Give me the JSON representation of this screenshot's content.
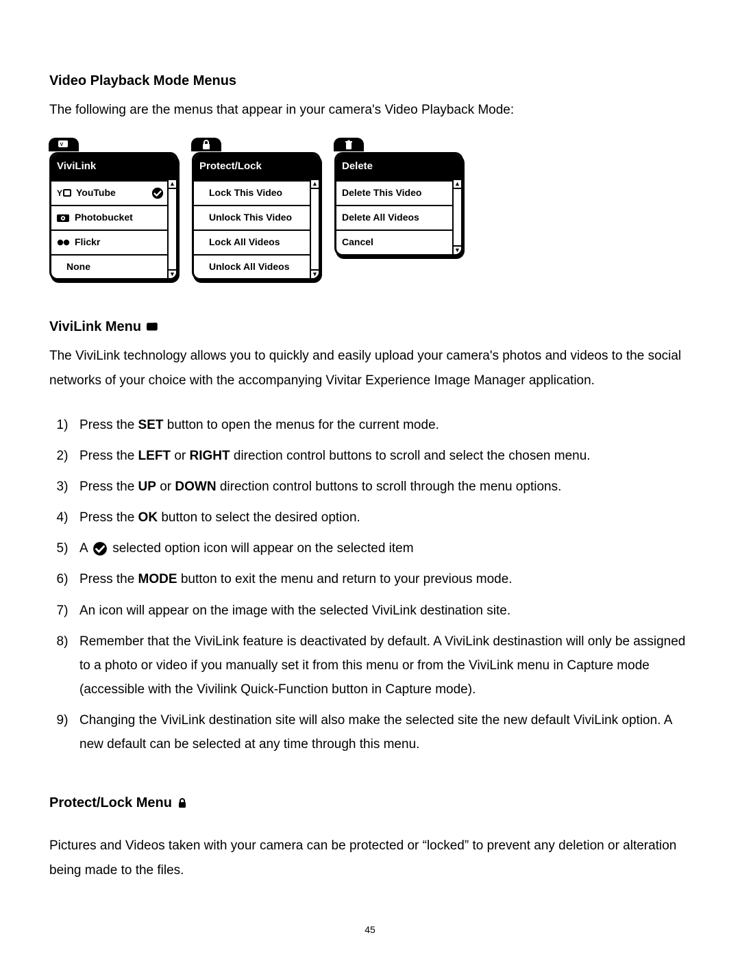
{
  "page": {
    "number": "45",
    "section1": {
      "title": "Video Playback Mode Menus",
      "intro": "The following are the menus that appear in your camera's Video Playback Mode:"
    },
    "menus": {
      "vivilink": {
        "title": "ViviLink",
        "items": [
          {
            "label": "YouTube",
            "icon": "youtube",
            "checked": true
          },
          {
            "label": "Photobucket",
            "icon": "photobucket",
            "checked": false
          },
          {
            "label": "Flickr",
            "icon": "flickr",
            "checked": false
          },
          {
            "label": "None",
            "icon": "",
            "checked": false
          }
        ]
      },
      "protect": {
        "title": "Protect/Lock",
        "items": [
          {
            "label": "Lock This Video"
          },
          {
            "label": "Unlock This Video"
          },
          {
            "label": "Lock All Videos"
          },
          {
            "label": "Unlock All Videos"
          }
        ]
      },
      "delete": {
        "title": "Delete",
        "items": [
          {
            "label": "Delete This Video"
          },
          {
            "label": "Delete All Videos"
          },
          {
            "label": "Cancel"
          }
        ]
      }
    },
    "section2": {
      "title": "ViviLink Menu",
      "intro": "The ViviLink technology allows you to quickly and easily upload your camera's photos and videos to the social networks of your choice with the accompanying Vivitar Experience Image Manager application.",
      "steps": {
        "s1_a": "Press the ",
        "s1_b": "SET",
        "s1_c": " button to open the menus for the current mode.",
        "s2_a": "Press the ",
        "s2_b": "LEFT",
        "s2_c": " or ",
        "s2_d": "RIGHT",
        "s2_e": " direction control buttons to scroll and select the chosen menu.",
        "s3_a": "Press the ",
        "s3_b": "UP",
        "s3_c": " or ",
        "s3_d": "DOWN",
        "s3_e": " direction control buttons to scroll through the menu options.",
        "s4_a": "Press the ",
        "s4_b": "OK",
        "s4_c": " button to select the desired option.",
        "s5_a": "A ",
        "s5_b": "selected option icon will appear on the selected item",
        "s6_a": "Press the ",
        "s6_b": "MODE",
        "s6_c": " button to exit the menu and return to your previous mode.",
        "s7": "An icon will appear on the image with the selected ViviLink destination site.",
        "s8": "Remember that the ViviLink feature is deactivated by default. A ViviLink destinastion will only be assigned to a photo or video if you manually set it from this menu or from the ViviLink menu in Capture mode (accessible with the Vivilink Quick-Function button in Capture mode).",
        "s9": "Changing the ViviLink destination site will also make the selected site the new default ViviLink option. A new default can be selected at any time through this menu."
      }
    },
    "section3": {
      "title": "Protect/Lock Menu",
      "intro": "Pictures and Videos taken with your camera can be protected or “locked” to prevent any deletion or alteration being made to the files."
    }
  }
}
